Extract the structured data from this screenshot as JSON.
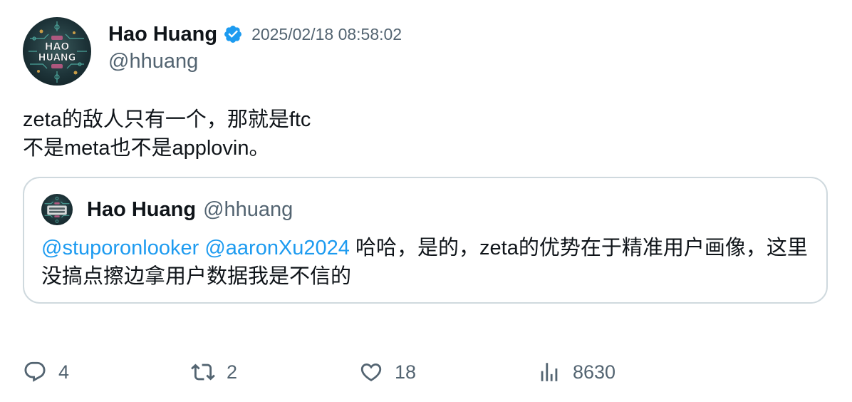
{
  "tweet": {
    "author": {
      "display_name": "Hao Huang",
      "handle": "@hhuang",
      "verified": true,
      "avatar_text_line1": "HAO",
      "avatar_text_line2": "HUANG"
    },
    "timestamp": "2025/02/18 08:58:02",
    "text_lines": [
      "zeta的敌人只有一个，那就是ftc",
      "不是meta也不是applovin。"
    ]
  },
  "quote": {
    "author": {
      "display_name": "Hao Huang",
      "handle": "@hhuang"
    },
    "mentions": [
      "@stuporonlooker",
      "@aaronXu2024"
    ],
    "text": "哈哈，是的，zeta的优势在于精准用户画像，这里没搞点擦边拿用户数据我是不信的"
  },
  "actions": {
    "replies": "4",
    "retweets": "2",
    "likes": "18",
    "views": "8630"
  },
  "colors": {
    "text": "#0f1419",
    "secondary": "#536471",
    "link": "#1d9bf0",
    "border": "#cfd9de",
    "verified": "#1d9bf0"
  },
  "icons": {
    "verified": "verified-badge-icon",
    "reply": "reply-icon",
    "retweet": "retweet-icon",
    "like": "heart-icon",
    "views": "analytics-icon"
  }
}
